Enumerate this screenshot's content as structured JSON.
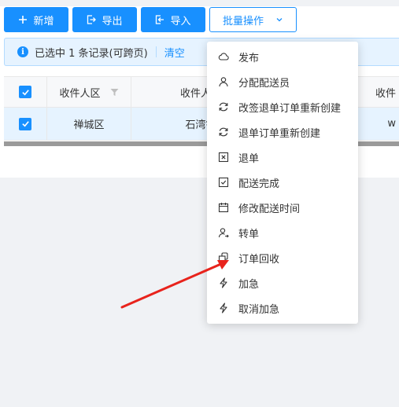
{
  "toolbar": {
    "add_label": "新增",
    "export_label": "导出",
    "import_label": "导入",
    "batch_label": "批量操作"
  },
  "alert": {
    "selected_text": "已选中 1 条记录(可跨页)",
    "clear_label": "清空"
  },
  "table": {
    "headers": [
      "收件人区",
      "收件人街道",
      "收件"
    ],
    "rows": [
      {
        "district": "禅城区",
        "street": "石湾镇街",
        "extra": "w"
      }
    ]
  },
  "batch_menu": {
    "items": [
      {
        "label": "发布",
        "icon": "cloud-icon"
      },
      {
        "label": "分配配送员",
        "icon": "user-icon"
      },
      {
        "label": "改签退单订单重新创建",
        "icon": "refresh-icon"
      },
      {
        "label": "退单订单重新创建",
        "icon": "refresh-icon"
      },
      {
        "label": "退单",
        "icon": "close-square-icon"
      },
      {
        "label": "配送完成",
        "icon": "check-square-icon"
      },
      {
        "label": "修改配送时间",
        "icon": "calendar-icon"
      },
      {
        "label": "转单",
        "icon": "user-transfer-icon"
      },
      {
        "label": "订单回收",
        "icon": "recycle-icon"
      },
      {
        "label": "加急",
        "icon": "lightning-icon"
      },
      {
        "label": "取消加急",
        "icon": "lightning-icon"
      }
    ]
  },
  "colors": {
    "primary": "#1890ff",
    "alert_bg": "#e6f3ff",
    "arrow": "#e8231c"
  }
}
